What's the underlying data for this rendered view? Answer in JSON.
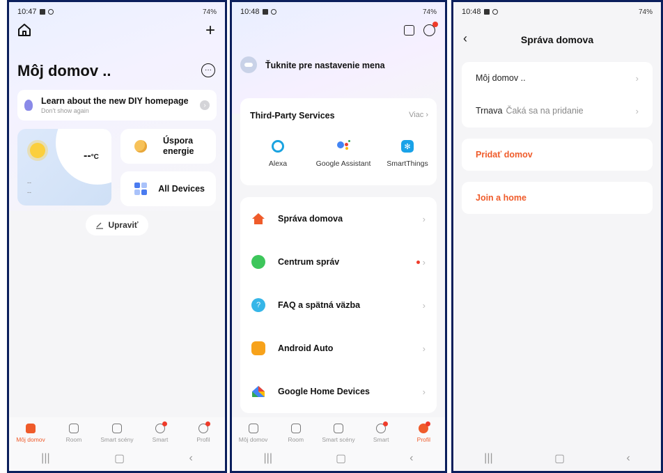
{
  "screen1": {
    "status_time": "10:47",
    "status_right": "74%",
    "title": "Môj domov ..",
    "banner_title": "Learn about the new DIY homepage",
    "banner_sub": "Don't show again",
    "temp": "--",
    "temp_unit": "°C",
    "weather_line1": "--",
    "weather_line2": "--",
    "tile1": "Úspora energie",
    "tile2": "All Devices",
    "edit": "Upraviť",
    "tabs": [
      "Môj domov",
      "Room",
      "Smart scény",
      "Smart",
      "Profil"
    ]
  },
  "screen2": {
    "status_time": "10:48",
    "status_right": "74%",
    "user_prompt": "Ťuknite pre nastavenie mena",
    "third_party_title": "Third-Party Services",
    "third_party_more": "Viac",
    "services": [
      "Alexa",
      "Google Assistant",
      "SmartThings"
    ],
    "menu": [
      "Správa domova",
      "Centrum správ",
      "FAQ a spätná väzba",
      "Android Auto",
      "Google Home Devices"
    ],
    "tabs": [
      "Môj domov",
      "Room",
      "Smart scény",
      "Smart",
      "Profil"
    ]
  },
  "screen3": {
    "status_time": "10:48",
    "status_right": "74%",
    "title": "Správa domova",
    "homes": [
      {
        "name": "Môj domov ..",
        "status": ""
      },
      {
        "name": "Trnava",
        "status": "Čaká sa na pridanie"
      }
    ],
    "add_home": "Pridať domov",
    "join_home": "Join a home"
  },
  "colors": {
    "accent": "#ef5b2a",
    "border": "#0b1f5c"
  }
}
